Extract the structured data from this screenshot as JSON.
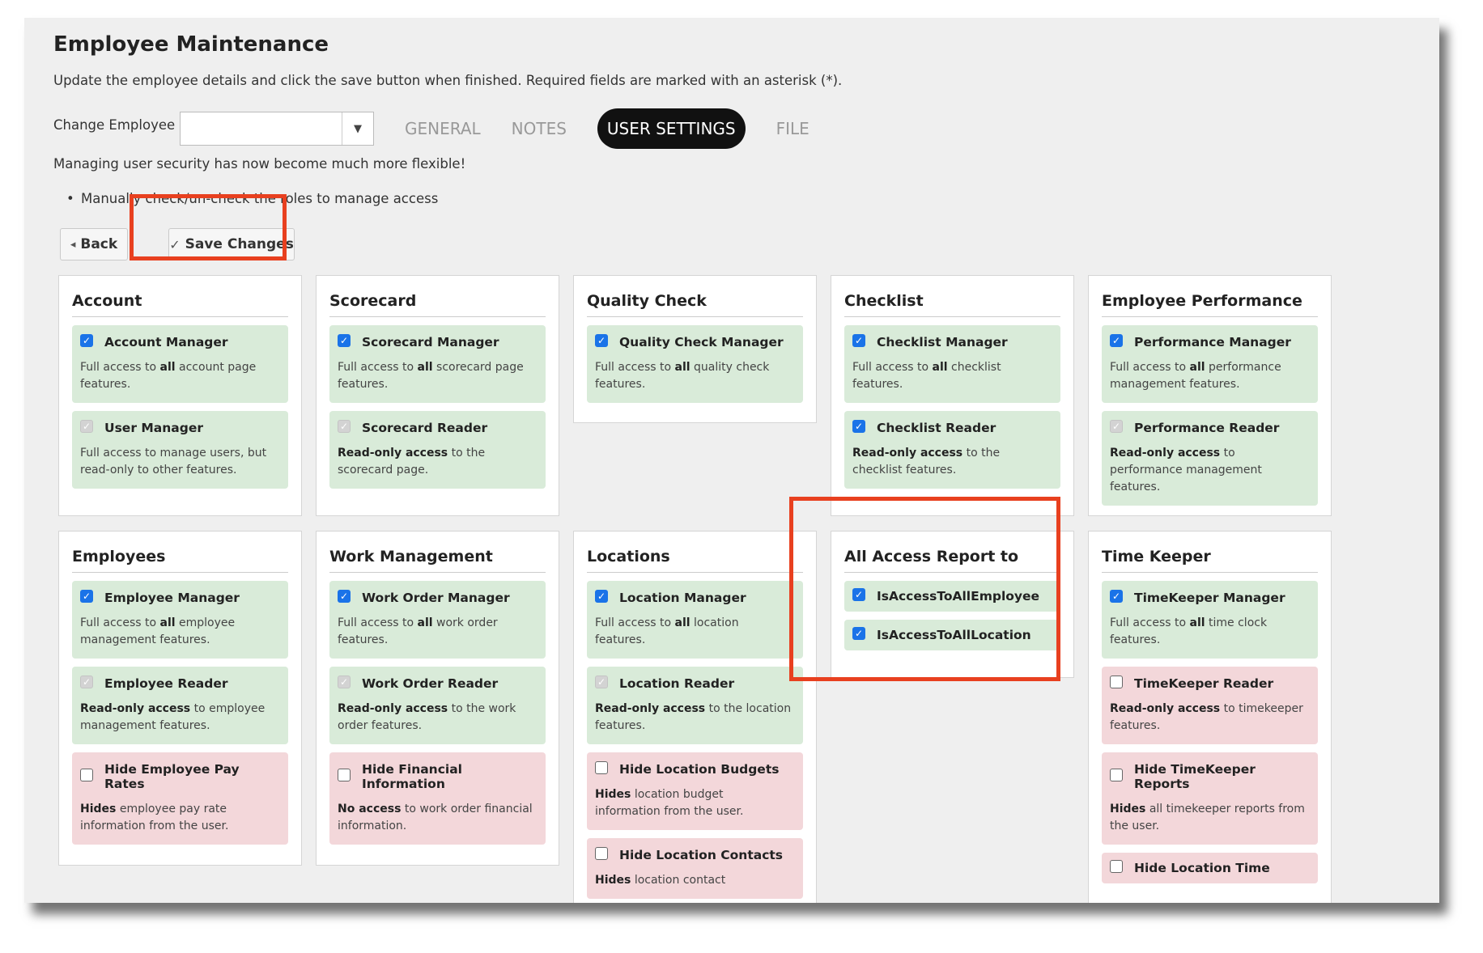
{
  "header": {
    "title": "Employee Maintenance",
    "subtitle": "Update the employee details and click the save button when finished. Required fields are marked with an asterisk (*).",
    "change_employee_label": "Change Employee",
    "change_employee_value": "",
    "notice": "Managing user security has now become much more flexible!",
    "bullet": "Manually check/un-check the roles to manage access"
  },
  "tabs": [
    {
      "label": "GENERAL",
      "active": false
    },
    {
      "label": "NOTES",
      "active": false
    },
    {
      "label": "USER SETTINGS",
      "active": true
    },
    {
      "label": "FILE",
      "active": false
    }
  ],
  "buttons": {
    "back": "Back",
    "save": "Save Changes"
  },
  "icons": {
    "back": "caret-left-icon",
    "save": "check-icon",
    "dropdown": "caret-down-icon"
  },
  "colors": {
    "highlight": "#e8401f",
    "granted": "#d9ebd9",
    "restricted": "#f3d7da",
    "checkbox": "#1a73e8"
  },
  "panels": [
    {
      "title": "Account",
      "roles": [
        {
          "name": "Account Manager",
          "state": "checked",
          "tone": "green",
          "desc": [
            [
              "",
              "Full access to "
            ],
            [
              "b",
              "all"
            ],
            [
              "",
              " account page features."
            ]
          ]
        },
        {
          "name": "User Manager",
          "state": "disabled",
          "tone": "green",
          "desc": [
            [
              "",
              "Full access to manage users, but read-only to other features."
            ]
          ]
        }
      ]
    },
    {
      "title": "Scorecard",
      "roles": [
        {
          "name": "Scorecard Manager",
          "state": "checked",
          "tone": "green",
          "desc": [
            [
              "",
              "Full access to "
            ],
            [
              "b",
              "all"
            ],
            [
              "",
              " scorecard page features."
            ]
          ]
        },
        {
          "name": "Scorecard Reader",
          "state": "disabled",
          "tone": "green",
          "desc": [
            [
              "b",
              "Read-only access"
            ],
            [
              "",
              " to the scorecard page."
            ]
          ]
        }
      ]
    },
    {
      "title": "Quality Check",
      "roles": [
        {
          "name": "Quality Check Manager",
          "state": "checked",
          "tone": "green",
          "desc": [
            [
              "",
              "Full access to "
            ],
            [
              "b",
              "all"
            ],
            [
              "",
              " quality check features."
            ]
          ]
        }
      ]
    },
    {
      "title": "Checklist",
      "roles": [
        {
          "name": "Checklist Manager",
          "state": "checked",
          "tone": "green",
          "desc": [
            [
              "",
              "Full access to "
            ],
            [
              "b",
              "all"
            ],
            [
              "",
              " checklist features."
            ]
          ]
        },
        {
          "name": "Checklist Reader",
          "state": "checked",
          "tone": "green",
          "desc": [
            [
              "b",
              "Read-only access"
            ],
            [
              "",
              " to the checklist features."
            ]
          ]
        }
      ]
    },
    {
      "title": "Employee Performance",
      "roles": [
        {
          "name": "Performance Manager",
          "state": "checked",
          "tone": "green",
          "desc": [
            [
              "",
              "Full access to "
            ],
            [
              "b",
              "all"
            ],
            [
              "",
              " performance management features."
            ]
          ]
        },
        {
          "name": "Performance Reader",
          "state": "disabled",
          "tone": "green",
          "desc": [
            [
              "b",
              "Read-only access"
            ],
            [
              "",
              " to performance management features."
            ]
          ]
        }
      ]
    },
    {
      "title": "Employees",
      "roles": [
        {
          "name": "Employee Manager",
          "state": "checked",
          "tone": "green",
          "desc": [
            [
              "",
              "Full access to "
            ],
            [
              "b",
              "all"
            ],
            [
              "",
              " employee management features."
            ]
          ]
        },
        {
          "name": "Employee Reader",
          "state": "disabled",
          "tone": "green",
          "desc": [
            [
              "b",
              "Read-only access"
            ],
            [
              "",
              " to employee management features."
            ]
          ]
        },
        {
          "name": "Hide Employee Pay Rates",
          "state": "unchecked",
          "tone": "red",
          "desc": [
            [
              "b",
              "Hides"
            ],
            [
              "",
              " employee pay rate information from the user."
            ]
          ]
        }
      ]
    },
    {
      "title": "Work Management",
      "roles": [
        {
          "name": "Work Order Manager",
          "state": "checked",
          "tone": "green",
          "desc": [
            [
              "",
              "Full access to "
            ],
            [
              "b",
              "all"
            ],
            [
              "",
              " work order features."
            ]
          ]
        },
        {
          "name": "Work Order Reader",
          "state": "disabled",
          "tone": "green",
          "desc": [
            [
              "b",
              "Read-only access"
            ],
            [
              "",
              " to the work order features."
            ]
          ]
        },
        {
          "name": "Hide Financial Information",
          "state": "unchecked",
          "tone": "red",
          "desc": [
            [
              "b",
              "No access"
            ],
            [
              "",
              " to work order financial information."
            ]
          ]
        }
      ]
    },
    {
      "title": "Locations",
      "roles": [
        {
          "name": "Location Manager",
          "state": "checked",
          "tone": "green",
          "desc": [
            [
              "",
              "Full access to "
            ],
            [
              "b",
              "all"
            ],
            [
              "",
              " location features."
            ]
          ]
        },
        {
          "name": "Location Reader",
          "state": "disabled",
          "tone": "green",
          "desc": [
            [
              "b",
              "Read-only access"
            ],
            [
              "",
              " to the location features."
            ]
          ]
        },
        {
          "name": "Hide Location Budgets",
          "state": "unchecked",
          "tone": "red",
          "desc": [
            [
              "b",
              "Hides"
            ],
            [
              "",
              " location budget information from the user."
            ]
          ]
        },
        {
          "name": "Hide Location Contacts",
          "state": "unchecked",
          "tone": "red",
          "desc": [
            [
              "b",
              "Hides"
            ],
            [
              "",
              " location contact"
            ]
          ]
        }
      ]
    },
    {
      "title": "All Access Report to",
      "roles": [
        {
          "name": "IsAccessToAllEmployee",
          "state": "checked",
          "tone": "green",
          "desc": []
        },
        {
          "name": "IsAccessToAllLocation",
          "state": "checked",
          "tone": "green",
          "desc": []
        }
      ]
    },
    {
      "title": "Time Keeper",
      "roles": [
        {
          "name": "TimeKeeper Manager",
          "state": "checked",
          "tone": "green",
          "desc": [
            [
              "",
              "Full access to "
            ],
            [
              "b",
              "all"
            ],
            [
              "",
              " time clock features."
            ]
          ]
        },
        {
          "name": "TimeKeeper Reader",
          "state": "unchecked",
          "tone": "red",
          "desc": [
            [
              "b",
              "Read-only access"
            ],
            [
              "",
              " to timekeeper features."
            ]
          ]
        },
        {
          "name": "Hide TimeKeeper Reports",
          "state": "unchecked",
          "tone": "red",
          "desc": [
            [
              "b",
              "Hides"
            ],
            [
              "",
              " all timekeeper reports from the user."
            ]
          ]
        },
        {
          "name": "Hide Location Time",
          "state": "unchecked",
          "tone": "red",
          "desc": []
        }
      ]
    }
  ]
}
